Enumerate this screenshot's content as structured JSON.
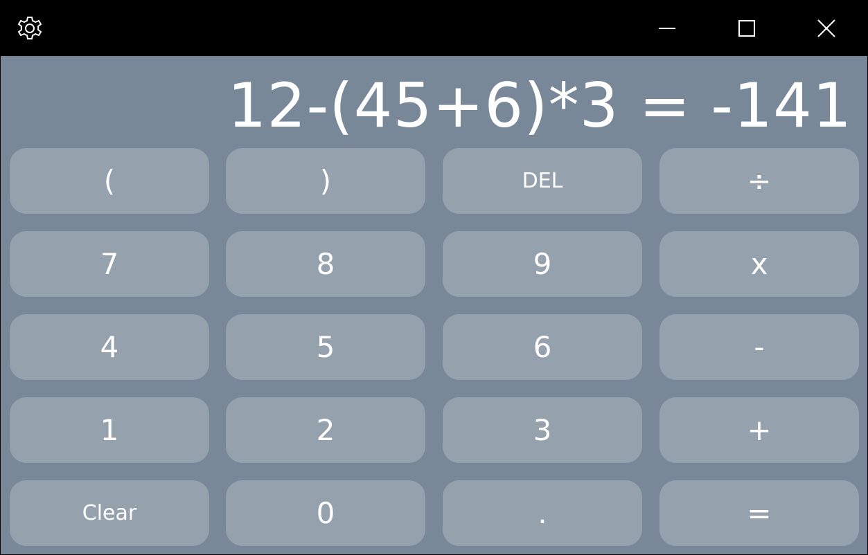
{
  "titlebar": {
    "icons": [
      "gear-icon",
      "minimize-icon",
      "maximize-icon",
      "close-icon"
    ]
  },
  "display": {
    "text": "12-(45+6)*3 = -141"
  },
  "keys": {
    "open_paren": "(",
    "close_paren": ")",
    "del": "DEL",
    "divide": "÷",
    "seven": "7",
    "eight": "8",
    "nine": "9",
    "multiply": "x",
    "four": "4",
    "five": "5",
    "six": "6",
    "minus": "-",
    "one": "1",
    "two": "2",
    "three": "3",
    "plus": "+",
    "clear": "Clear",
    "zero": "0",
    "decimal": ".",
    "equals": "="
  },
  "colors": {
    "titlebar": "#000000",
    "background": "#798898",
    "key": "#95a2ae",
    "text": "#ffffff"
  }
}
